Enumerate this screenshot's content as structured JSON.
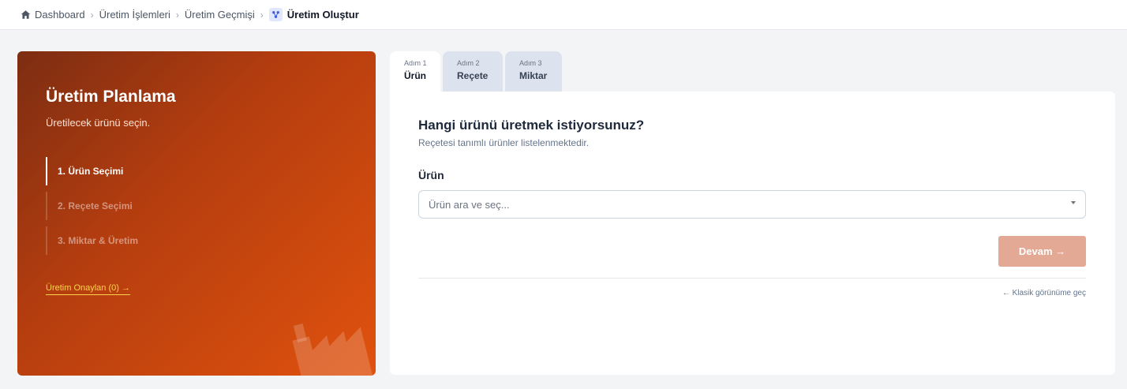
{
  "breadcrumb": {
    "items": [
      "Dashboard",
      "Üretim İşlemleri",
      "Üretim Geçmişi"
    ],
    "current": "Üretim Oluştur"
  },
  "hero": {
    "title": "Üretim Planlama",
    "subtitle": "Üretilecek ürünü seçin.",
    "steps": [
      "1. Ürün Seçimi",
      "2. Reçete Seçimi",
      "3. Miktar & Üretim"
    ],
    "active_step": 0,
    "approved_link": "Üretim Onaylan (0) →"
  },
  "tabs": [
    {
      "step": "Adım 1",
      "label": "Ürün"
    },
    {
      "step": "Adım 2",
      "label": "Reçete"
    },
    {
      "step": "Adım 3",
      "label": "Miktar"
    }
  ],
  "form": {
    "title": "Hangi ürünü üretmek istiyorsunuz?",
    "subtitle": "Reçetesi tanımlı ürünler listelenmektedir.",
    "field_label": "Ürün",
    "select_placeholder": "Ürün ara ve seç...",
    "continue_button": "Devam →",
    "classic_link": "← Klasik görünüme geç"
  },
  "colors": {
    "hero_start": "#7c2d12",
    "hero_end": "#e0520e",
    "continue_button": "#e4a994",
    "link_accent": "#fcd34d"
  },
  "icons": [
    "home-icon",
    "chevron-right-icon",
    "production-icon",
    "caret-down-icon"
  ]
}
